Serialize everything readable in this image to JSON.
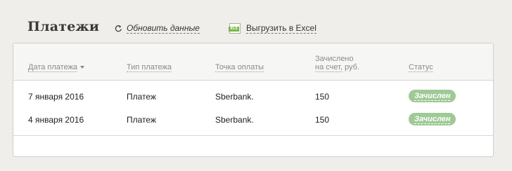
{
  "header": {
    "title": "Платежи",
    "refresh_label": "Обновить данные",
    "export_label": "Выгрузить в Excel",
    "export_icon_text": "XLS"
  },
  "table": {
    "columns": {
      "date": "Дата платежа",
      "type": "Тип платежа",
      "point": "Точка оплаты",
      "credited_line1": "Зачислено",
      "credited_line2_a": "на счет,",
      "credited_line2_b": "руб.",
      "status": "Статус"
    },
    "sort_icon": "chevron-down-icon",
    "rows": [
      {
        "date": "7 января 2016",
        "type": "Платеж",
        "point": "Sberbank.",
        "amount": "150",
        "status": "Зачислен"
      },
      {
        "date": "4 января 2016",
        "type": "Платеж",
        "point": "Sberbank.",
        "amount": "150",
        "status": "Зачислен"
      }
    ]
  },
  "colors": {
    "status_badge": "#9fc996",
    "excel_icon": "#7ab648"
  }
}
